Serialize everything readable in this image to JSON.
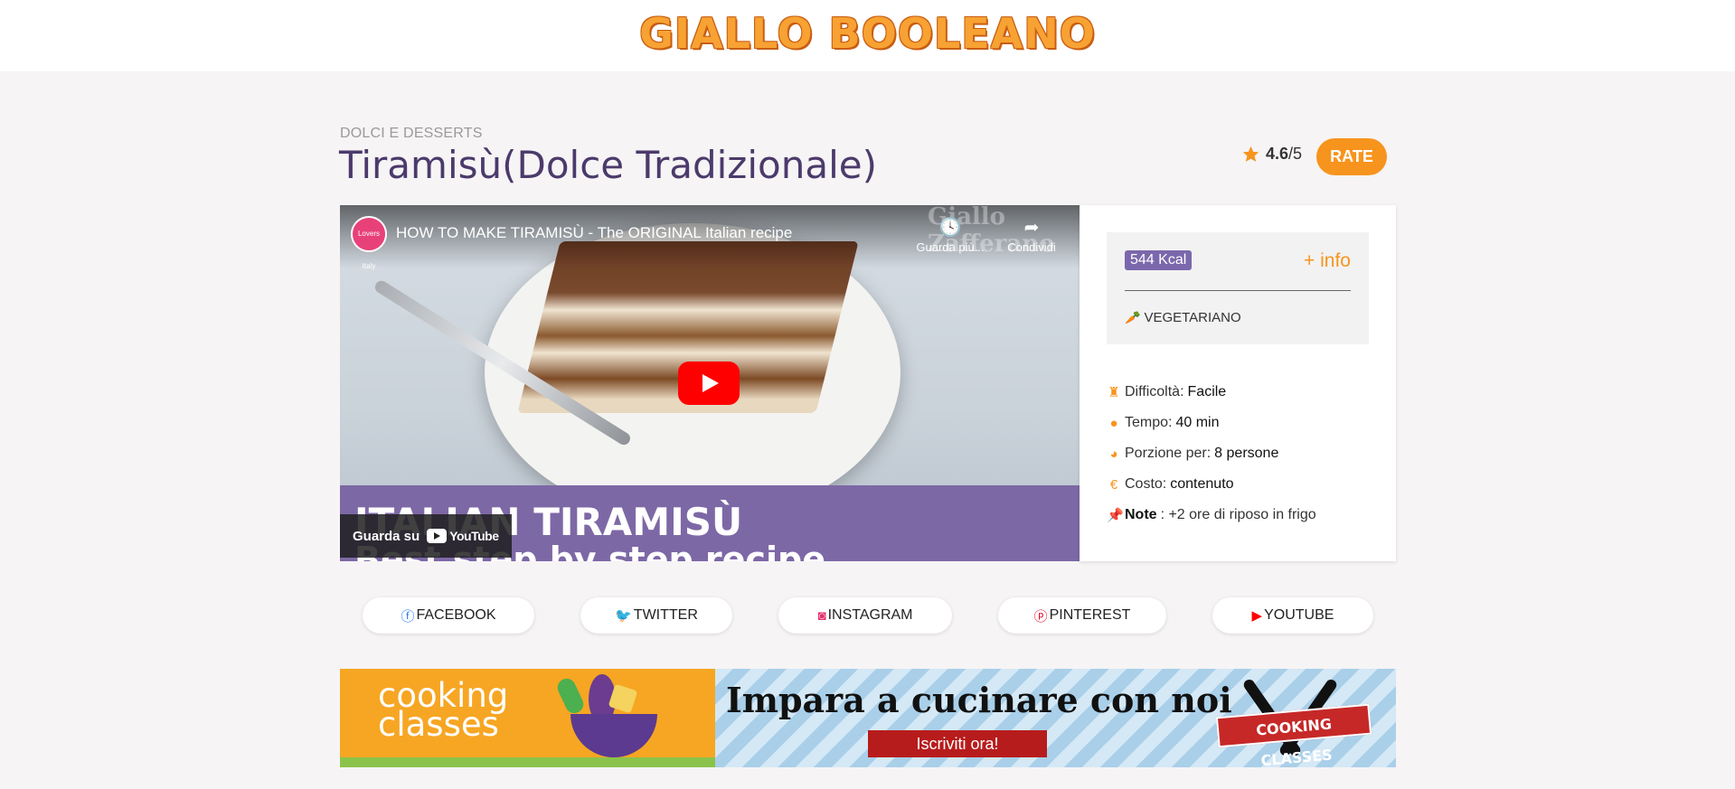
{
  "site": {
    "logo": "GIALLO BOOLEANO"
  },
  "recipe": {
    "category": "DOLCI E DESSERTS",
    "title": "Tiramisù(Dolce Tradizionale)",
    "rating_value": "4.6",
    "rating_scale": "/5",
    "rate_label": "RATE"
  },
  "video": {
    "title": "HOW TO MAKE TIRAMISÙ - The ORIGINAL Italian recipe",
    "avatar_text": "Lovers Italy",
    "watch_later_label": "Guarda più...",
    "share_label": "Condividi",
    "watermark": "Giallo Zafferano",
    "banner_line1": "ITALIAN TIRAMISÙ",
    "banner_line2": "Best step by step recipe",
    "watch_on_label": "Guarda su",
    "youtube_label": "YouTube"
  },
  "nutrition": {
    "kcal": "544 Kcal",
    "more_info": "+ info",
    "diet": "VEGETARIANO"
  },
  "details": [
    {
      "icon": "chef-hat-icon",
      "label": "Difficoltà: ",
      "value": "Facile"
    },
    {
      "icon": "clock-icon",
      "label": "Tempo: ",
      "value": "40 min"
    },
    {
      "icon": "pie-chart-icon",
      "label": "Porzione per: ",
      "value": "8 persone"
    },
    {
      "icon": "euro-icon",
      "label": "Costo: ",
      "value": "contenuto"
    }
  ],
  "note": {
    "label": "Note",
    "value": ": +2 ore di riposo in frigo"
  },
  "socials": [
    {
      "name": "FACEBOOK",
      "icon": "facebook-icon",
      "color": "#1877f2"
    },
    {
      "name": "TWITTER",
      "icon": "twitter-icon",
      "color": "#1da1f2"
    },
    {
      "name": "INSTAGRAM",
      "icon": "instagram-icon",
      "color": "#e1306c"
    },
    {
      "name": "PINTEREST",
      "icon": "pinterest-icon",
      "color": "#e60023"
    },
    {
      "name": "YOUTUBE",
      "icon": "youtube-icon",
      "color": "#ff0000"
    }
  ],
  "ad": {
    "brand": "cooking\nclasses",
    "headline": "Impara a cucinare con noi",
    "cta": "Iscriviti ora!",
    "badge": "COOKING CLASSES"
  },
  "colors": {
    "accent": "#f7941d",
    "title": "#4b3a6b",
    "kcal_badge": "#7b68ac"
  }
}
